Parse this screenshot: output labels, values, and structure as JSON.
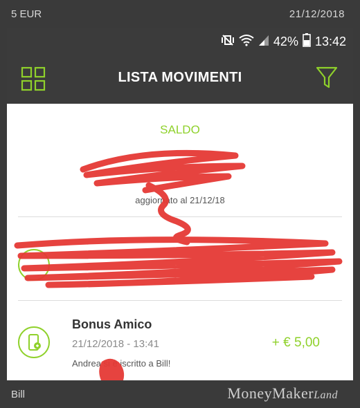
{
  "top_strip": {
    "left": "5 EUR",
    "right": "21/12/2018"
  },
  "status_bar": {
    "battery": "42%",
    "time": "13:42"
  },
  "app_bar": {
    "title": "LISTA MOVIMENTI"
  },
  "balance": {
    "label": "SALDO",
    "updated": "aggiornato al 21/12/18"
  },
  "movements": [
    {
      "title": "Bonus Amico",
      "datetime": "21/12/2018 - 13:41",
      "description": "Andrea       si è iscritto a Bill!",
      "amount": "+ € 5,00",
      "icon": "phone-icon"
    }
  ],
  "bottom_strip": {
    "left": "Bill"
  },
  "watermark": {
    "main": "MoneyMaker",
    "suffix": "Land"
  },
  "colors": {
    "accent": "#8fd12b",
    "bar": "#3b3b3b",
    "redaction": "#e53935"
  }
}
